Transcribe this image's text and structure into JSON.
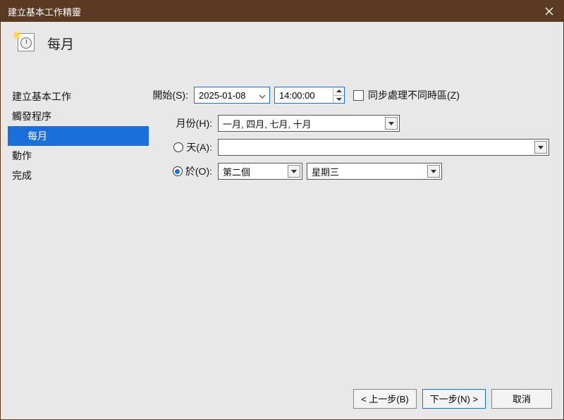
{
  "window": {
    "title": "建立基本工作精靈"
  },
  "header": {
    "title": "每月"
  },
  "sidebar": {
    "items": [
      {
        "label": "建立基本工作"
      },
      {
        "label": "觸發程序"
      },
      {
        "label": "每月",
        "sub": true,
        "selected": true
      },
      {
        "label": "動作"
      },
      {
        "label": "完成"
      }
    ]
  },
  "form": {
    "start_label": "開始(S):",
    "date_value": "2025-01-08",
    "time_value": "14:00:00",
    "sync_tz_label": "同步處理不同時區(Z)",
    "months_label": "月份(H):",
    "months_value": "一月, 四月, 七月, 十月",
    "days_label": "天(A):",
    "days_value": "",
    "on_label": "於(O):",
    "on_ordinal": "第二個",
    "on_weekday": "星期三"
  },
  "footer": {
    "back": "< 上一步(B)",
    "next": "下一步(N) >",
    "cancel": "取消"
  }
}
